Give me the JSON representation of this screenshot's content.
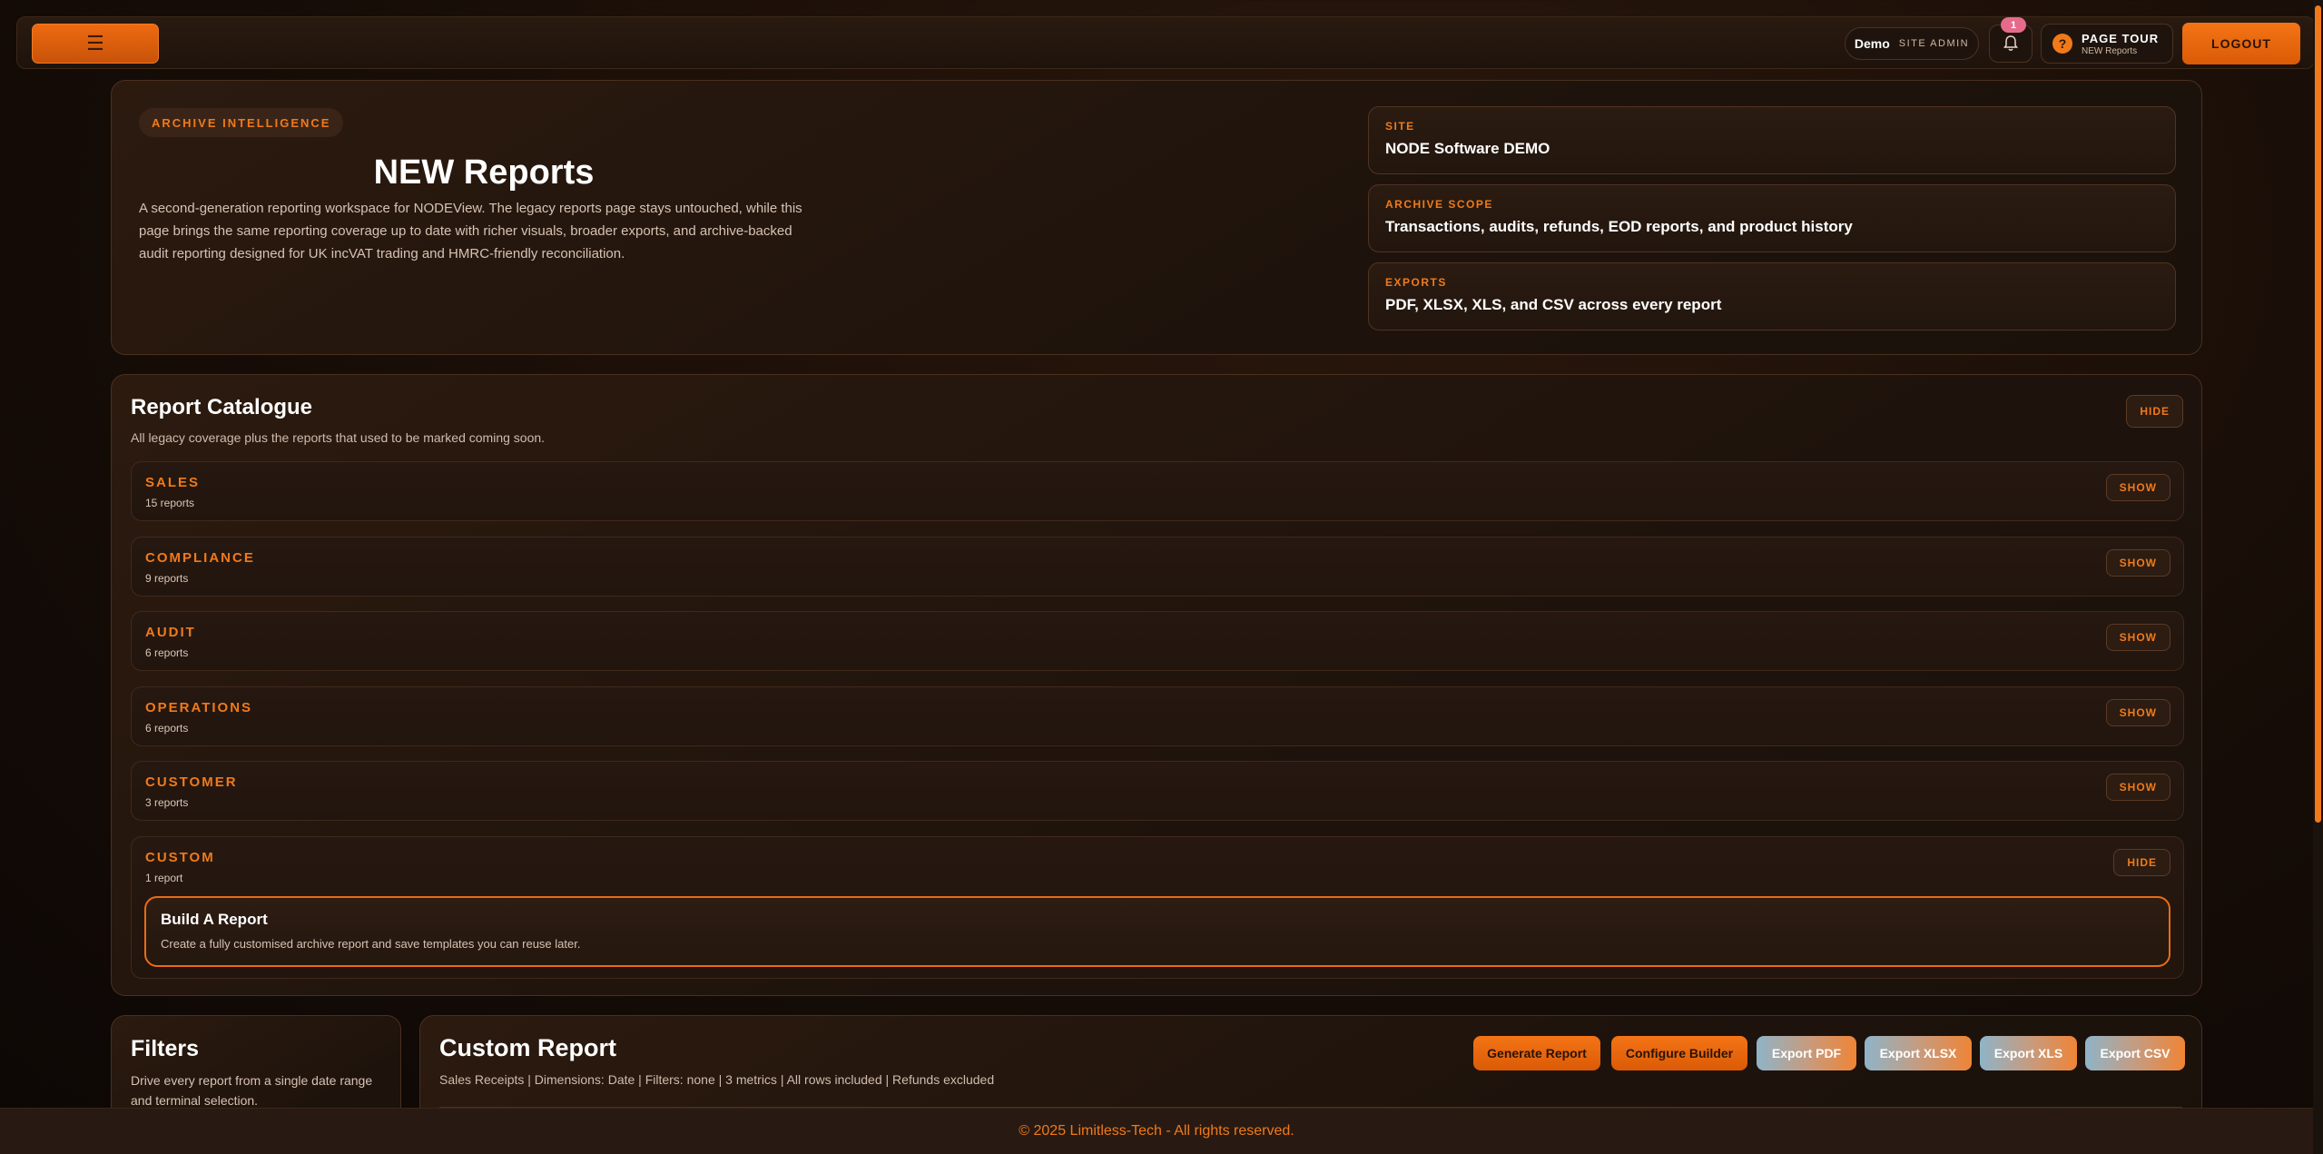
{
  "topbar": {
    "menu_icon": "hamburger-icon",
    "user_name": "Demo",
    "user_role": "SITE ADMIN",
    "notification_count": "1",
    "tour_icon": "?",
    "tour_title": "PAGE TOUR",
    "tour_subtitle": "NEW Reports",
    "logout_label": "LOGOUT"
  },
  "hero": {
    "eyebrow": "ARCHIVE INTELLIGENCE",
    "title": "NEW Reports",
    "description": "A second-generation reporting workspace for NODEView. The legacy reports page stays untouched, while this page brings the same reporting coverage up to date with richer visuals, broader exports, and archive-backed audit reporting designed for UK incVAT trading and HMRC-friendly reconciliation.",
    "cards": [
      {
        "label": "SITE",
        "value": "NODE Software DEMO"
      },
      {
        "label": "ARCHIVE SCOPE",
        "value": "Transactions, audits, refunds, EOD reports, and product history"
      },
      {
        "label": "EXPORTS",
        "value": "PDF, XLSX, XLS, and CSV across every report"
      }
    ]
  },
  "catalogue": {
    "title": "Report Catalogue",
    "subtitle": "All legacy coverage plus the reports that used to be marked coming soon.",
    "toggle_label": "HIDE",
    "rows": [
      {
        "name": "SALES",
        "count": "15 reports",
        "toggle": "SHOW"
      },
      {
        "name": "COMPLIANCE",
        "count": "9 reports",
        "toggle": "SHOW"
      },
      {
        "name": "AUDIT",
        "count": "6 reports",
        "toggle": "SHOW"
      },
      {
        "name": "OPERATIONS",
        "count": "6 reports",
        "toggle": "SHOW"
      },
      {
        "name": "CUSTOMER",
        "count": "3 reports",
        "toggle": "SHOW"
      },
      {
        "name": "CUSTOM",
        "count": "1 report",
        "toggle": "HIDE"
      }
    ],
    "custom_item": {
      "title": "Build A Report",
      "description": "Create a fully customised archive report and save templates you can reuse later."
    }
  },
  "filters": {
    "title": "Filters",
    "description": "Drive every report from a single date range and terminal selection."
  },
  "custom_report": {
    "title": "Custom Report",
    "summary": "Sales Receipts | Dimensions: Date | Filters: none | 3 metrics | All rows included | Refunds excluded",
    "actions": {
      "generate": "Generate Report",
      "configure": "Configure Builder",
      "export_pdf": "Export PDF",
      "export_xlsx": "Export XLSX",
      "export_xls": "Export XLS",
      "export_csv": "Export CSV"
    }
  },
  "footer": {
    "text": "© 2025 Limitless-Tech - All rights reserved."
  },
  "colors": {
    "accent": "#f07a1a",
    "background": "#170d07",
    "panel": "#1e130c",
    "badge": "#e66a8c"
  }
}
